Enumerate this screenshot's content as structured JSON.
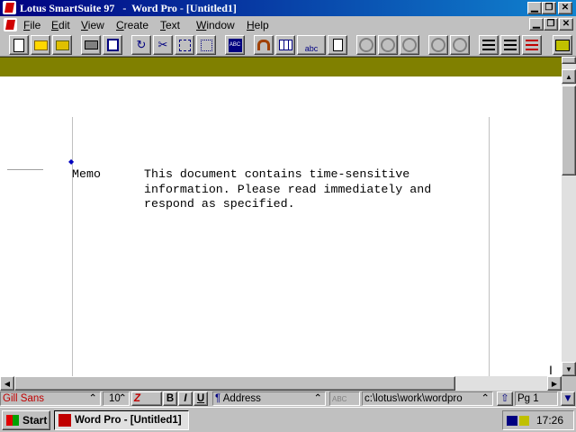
{
  "window": {
    "app_name": "Lotus SmartSuite 97",
    "title": "Word Pro - [Untitled1]",
    "separator": "-"
  },
  "menu": {
    "items": [
      {
        "label": "File",
        "u": "F",
        "rest": "ile"
      },
      {
        "label": "Edit",
        "u": "E",
        "rest": "dit"
      },
      {
        "label": "View",
        "u": "V",
        "rest": "iew"
      },
      {
        "label": "Create",
        "u": "C",
        "rest": "reate"
      },
      {
        "label": "Text",
        "u": "T",
        "rest": "ext"
      },
      {
        "label": "Window",
        "u": "W",
        "rest": "indow"
      },
      {
        "label": "Help",
        "u": "H",
        "rest": "elp"
      }
    ]
  },
  "toolbar": {
    "icons": [
      "new-document-icon",
      "open-folder-icon",
      "open-smartmaster-icon",
      "print-icon",
      "print-preview-icon",
      "undo-icon",
      "cut-icon",
      "copy-icon",
      "paste-icon",
      "spell-check-icon",
      "fast-format-icon",
      "table-icon",
      "insert-frame-icon",
      "insert-click-here-icon",
      "bold-text-icon",
      "italic-text-icon",
      "underline-text-icon",
      "indent-icon",
      "outdent-icon",
      "bullets-icon",
      "numbering-icon",
      "list-icon",
      "smarticons-icon"
    ],
    "abc_label": "abc"
  },
  "document": {
    "label": "Memo",
    "lines": [
      "This document contains time-sensitive",
      "information. Please read immediately and",
      "respond as specified."
    ]
  },
  "statusbar": {
    "font": "Gill Sans",
    "font_size": "10",
    "bold": "B",
    "italic": "I",
    "underline": "U",
    "style": "Address",
    "path": "c:\\lotus\\work\\wordpro",
    "page": "Pg 1",
    "colors": {
      "font_red": "#c00000",
      "olive": "#808000"
    }
  },
  "taskbar": {
    "start_label": "Start",
    "task_label": "Word Pro - [Untitled1]",
    "clock": "17:26"
  }
}
